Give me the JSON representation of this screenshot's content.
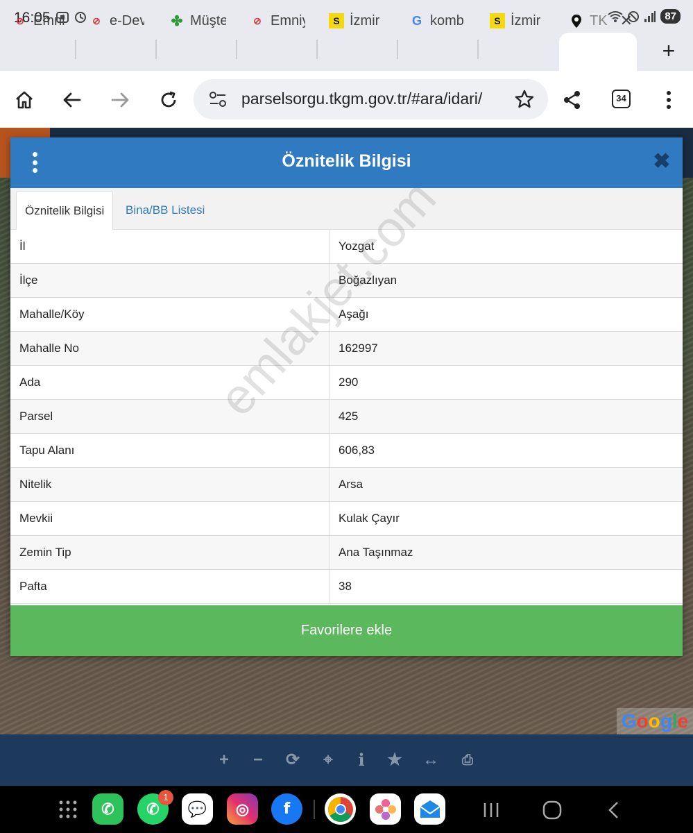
{
  "status_bar": {
    "time": "16:05",
    "battery": "87"
  },
  "browser": {
    "tabs": [
      {
        "label": "Emniy",
        "icon": "edevlet-icon"
      },
      {
        "label": "e-Dev",
        "icon": "edevlet-icon"
      },
      {
        "label": "Müşte",
        "icon": "clover-icon"
      },
      {
        "label": "Emniy",
        "icon": "edevlet-icon"
      },
      {
        "label": "İzmir",
        "icon": "s-icon"
      },
      {
        "label": "komb",
        "icon": "google-icon"
      },
      {
        "label": "İzmir",
        "icon": "s-icon"
      },
      {
        "label": "TK",
        "icon": "map-pin-icon"
      }
    ],
    "url": "parselsorgu.tkgm.gov.tr/#ara/idari/",
    "tab_count": "34"
  },
  "modal": {
    "title": "Öznitelik Bilgisi",
    "tabs": {
      "active": "Öznitelik Bilgisi",
      "inactive": "Bina/BB Listesi"
    },
    "rows": [
      {
        "key": "İl",
        "value": "Yozgat"
      },
      {
        "key": "İlçe",
        "value": "Boğazlıyan"
      },
      {
        "key": "Mahalle/Köy",
        "value": "Aşağı"
      },
      {
        "key": "Mahalle No",
        "value": "162997"
      },
      {
        "key": "Ada",
        "value": "290"
      },
      {
        "key": "Parsel",
        "value": "425"
      },
      {
        "key": "Tapu Alanı",
        "value": "606,83"
      },
      {
        "key": "Nitelik",
        "value": "Arsa"
      },
      {
        "key": "Mevkii",
        "value": "Kulak Çayır"
      },
      {
        "key": "Zemin Tip",
        "value": "Ana Taşınmaz"
      },
      {
        "key": "Pafta",
        "value": "38"
      }
    ],
    "favorite_button": "Favorilere ekle"
  },
  "watermark": "emlakjet.com",
  "map": {
    "google_logo": "Google",
    "tools": [
      "zoom-in-icon",
      "zoom-out-icon",
      "refresh-icon",
      "locate-icon",
      "info-icon",
      "star-icon",
      "measure-icon",
      "print-icon"
    ]
  },
  "dock": {
    "whatsapp_badge": "1"
  },
  "colors": {
    "header_blue": "#2f7ac0",
    "favorite_green": "#5cb85c",
    "map_toolbar": "#1d3a5c"
  }
}
